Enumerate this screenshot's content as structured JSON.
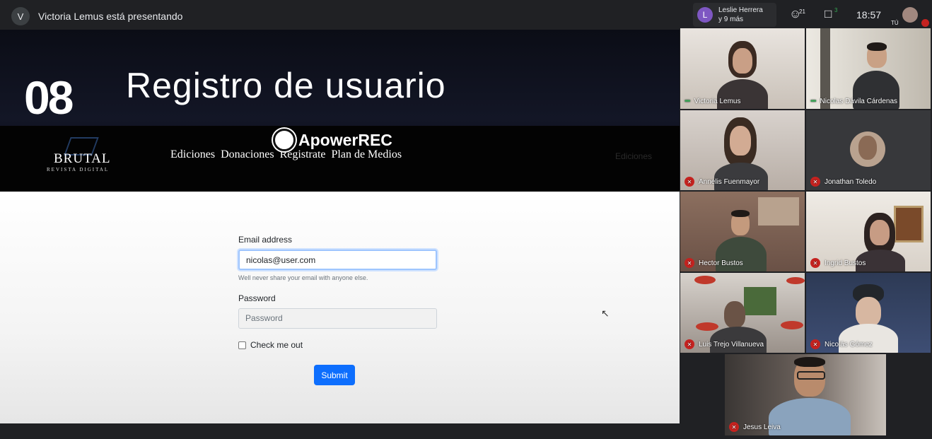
{
  "meet": {
    "presenter_initial": "V",
    "presenter_text": "Victoria Lemus está presentando",
    "active_speaker": {
      "initial": "L",
      "name": "Leslie Herrera",
      "more": "y 9 más"
    },
    "people_count": "21",
    "chat_count": "3",
    "time": "18:57",
    "self_label": "TÚ"
  },
  "slide": {
    "number": "08",
    "title": "Registro de usuario",
    "brand": "BRUTAL",
    "brand_sub": "REVISTA DIGITAL",
    "recorder": "ApowerREC",
    "nav": [
      "Ediciones",
      "Donaciones",
      "Registrate",
      "Plan de Medios"
    ],
    "nav_ghost": "Ediciones",
    "form": {
      "email_label": "Email address",
      "email_value": "nicolas@user.com",
      "email_help": "Well never share your email with anyone else.",
      "password_label": "Password",
      "password_placeholder": "Password",
      "check_label": "Check me out",
      "submit": "Submit"
    }
  },
  "participants": [
    {
      "name": "Victoria Lemus",
      "status": "speaking"
    },
    {
      "name": "Nicolas Dávila Cárdenas",
      "status": "speaking"
    },
    {
      "name": "Annelis Fuenmayor",
      "status": "muted"
    },
    {
      "name": "Jonathan Toledo",
      "status": "muted"
    },
    {
      "name": "Hector Bustos",
      "status": "muted"
    },
    {
      "name": "Ingrid Bustos",
      "status": "muted"
    },
    {
      "name": "Luis Trejo Villanueva",
      "status": "muted"
    },
    {
      "name": "Nicolás Gómez",
      "status": "muted"
    },
    {
      "name": "Jesus Leiva",
      "status": "muted"
    }
  ],
  "colors": {
    "meet_bg": "#202124",
    "submit": "#0d6efd",
    "mute_red": "#c5221f",
    "speaking_green": "#34a853"
  }
}
